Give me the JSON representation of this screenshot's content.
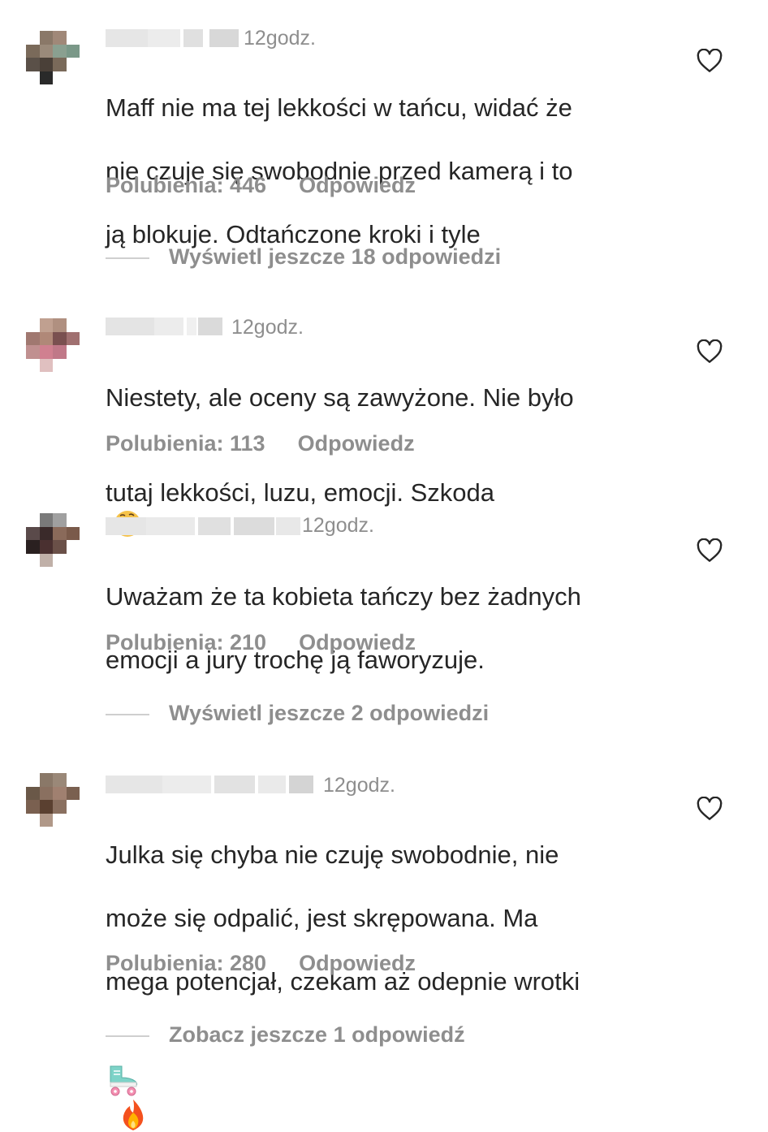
{
  "comments": [
    {
      "time": "12godz.",
      "text_lines": [
        "Maff nie ma tej lekkości w tańcu, widać że",
        "nie czuje się swobodnie przed kamerą i to",
        "ją blokuje. Odtańczone kroki i tyle"
      ],
      "likes": "Polubienia: 446",
      "reply": "Odpowiedz",
      "view_replies": "Wyświetl jeszcze 18 odpowiedzi",
      "avatar_colors": [
        "#ffffff",
        "#8a7868",
        "#a08878",
        "#ffffff",
        "#7a6a5a",
        "#9a8a7a",
        "#8aa090",
        "#7a9888",
        "#5a5048",
        "#4a4038",
        "#7a6a5a",
        "#ffffff",
        "#ffffff",
        "#2a2a2a",
        "#ffffff",
        "#ffffff"
      ]
    },
    {
      "time": "12godz.",
      "text_lines": [
        "Niestety, ale oceny są zawyżone. Nie było",
        "tutaj lekkości, luzu, emocji. Szkoda"
      ],
      "emoji_after": "thinking-face",
      "likes": "Polubienia: 113",
      "reply": "Odpowiedz",
      "view_replies": "",
      "avatar_colors": [
        "#ffffff",
        "#c0a090",
        "#b09080",
        "#ffffff",
        "#a07870",
        "#b08878",
        "#7a5050",
        "#a07070",
        "#c09090",
        "#d08090",
        "#c07888",
        "#ffffff",
        "#ffffff",
        "#e0c0c0",
        "#ffffff",
        "#ffffff"
      ]
    },
    {
      "time": "12godz.",
      "text_lines": [
        "Uważam że ta kobieta tańczy bez żadnych",
        "emocji a jury trochę ją faworyzuje."
      ],
      "likes": "Polubienia: 210",
      "reply": "Odpowiedz",
      "view_replies": "Wyświetl jeszcze 2 odpowiedzi",
      "avatar_colors": [
        "#ffffff",
        "#7a7a7a",
        "#a0a0a0",
        "#ffffff",
        "#5a4a4a",
        "#3a2a2a",
        "#8a6a5a",
        "#7a5a4a",
        "#2a2020",
        "#4a3030",
        "#6a5048",
        "#ffffff",
        "#ffffff",
        "#c0b0a8",
        "#ffffff",
        "#ffffff"
      ]
    },
    {
      "time": "12godz.",
      "text_lines": [
        "Julka się chyba nie czuję swobodnie, nie",
        "może się odpalić, jest skrępowana. Ma",
        "mega potencjał, czekam aż odepnie wrotki"
      ],
      "emoji_line": [
        "roller-skate",
        "fire"
      ],
      "likes": "Polubienia: 280",
      "reply": "Odpowiedz",
      "view_replies": "Zobacz jeszcze 1 odpowiedź",
      "avatar_colors": [
        "#ffffff",
        "#8a7868",
        "#9a8878",
        "#ffffff",
        "#6a5848",
        "#8a7060",
        "#a08070",
        "#7a6050",
        "#7a6050",
        "#5a4030",
        "#8a7060",
        "#ffffff",
        "#ffffff",
        "#b09888",
        "#ffffff",
        "#ffffff"
      ]
    }
  ]
}
